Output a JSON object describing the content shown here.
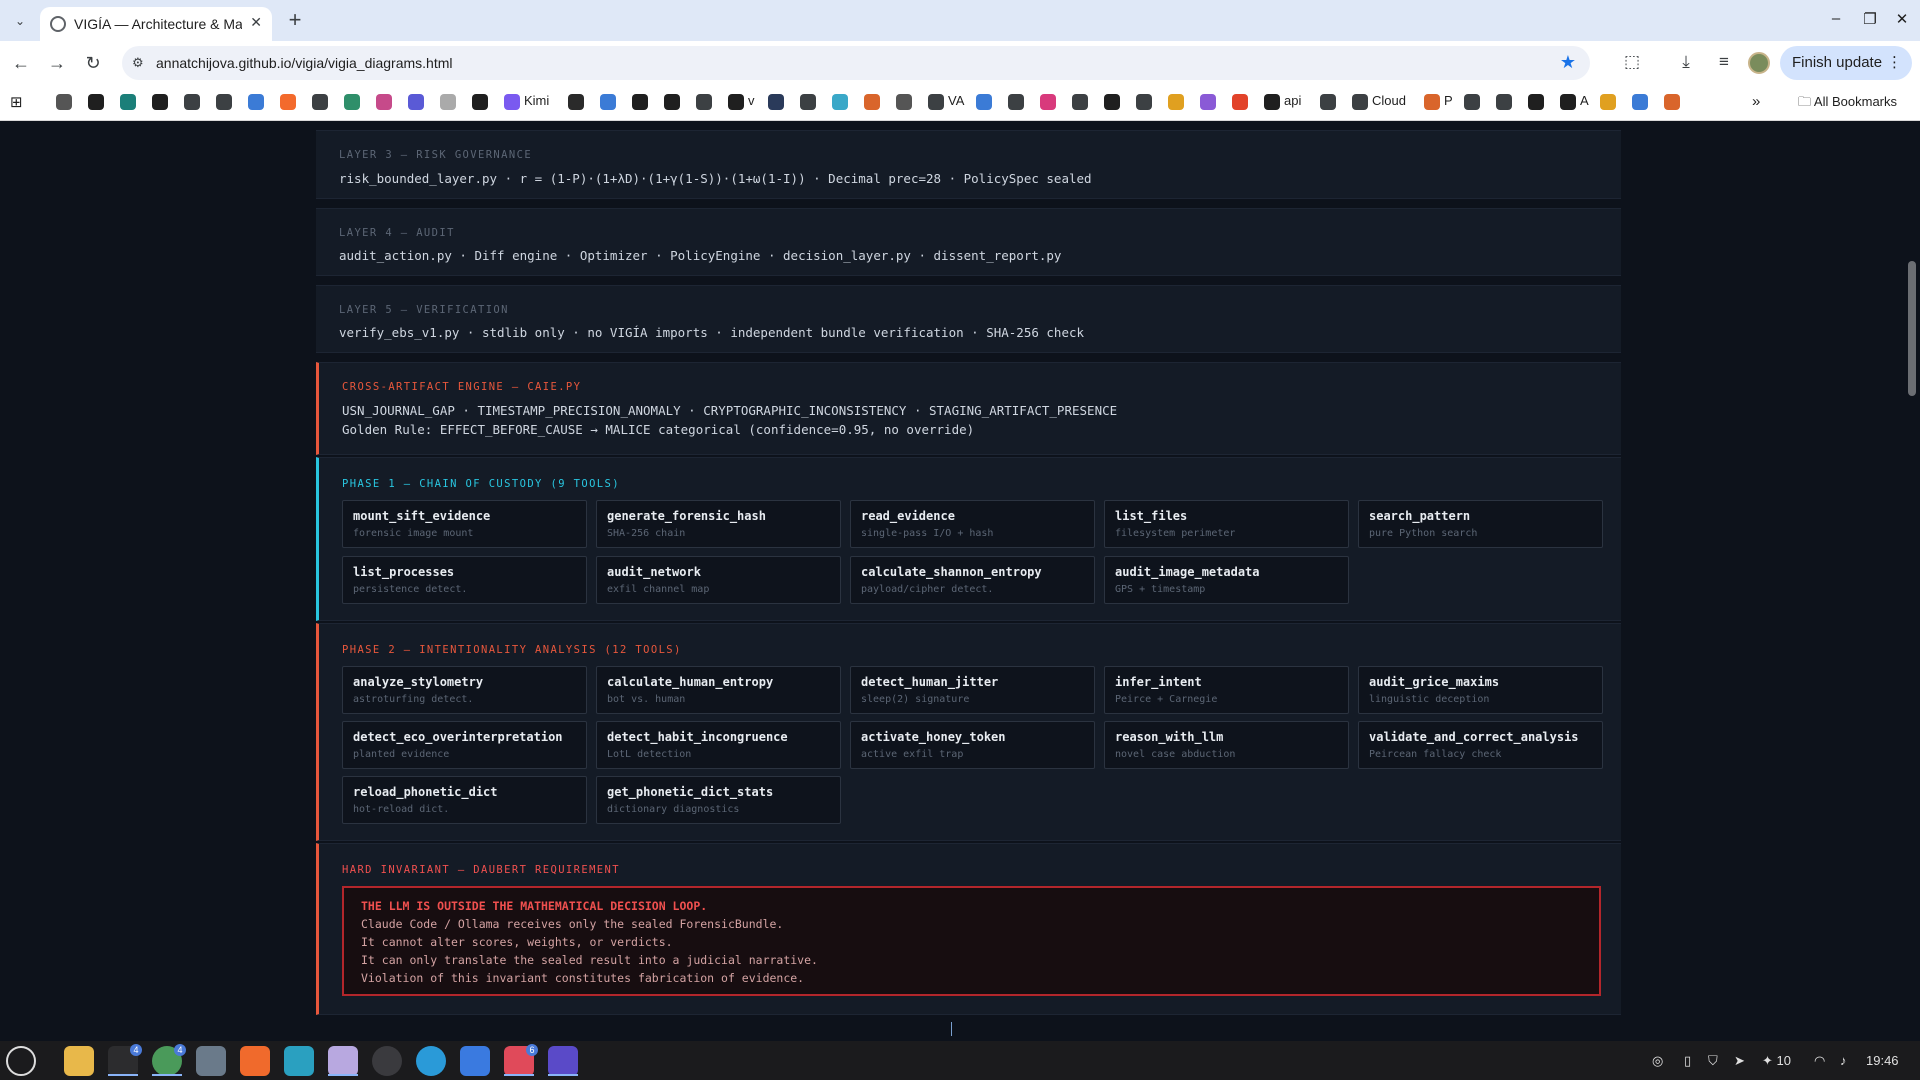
{
  "browser": {
    "tab_title": "VIGÍA — Architecture & Mat",
    "url": "annatchijova.github.io/vigia/vigia_diagrams.html",
    "finish_update": "Finish update",
    "all_bookmarks": "All Bookmarks",
    "bookmarks": [
      {
        "label": "",
        "icon": "ai-icon",
        "color": "#555555"
      },
      {
        "label": "",
        "icon": "github-icon",
        "color": "#1f1f1f"
      },
      {
        "label": "",
        "icon": "app-icon",
        "color": "#1b7f79"
      },
      {
        "label": "",
        "icon": "openai-icon",
        "color": "#1f1f1f"
      },
      {
        "label": "",
        "icon": "globe-icon",
        "color": "#3c4043"
      },
      {
        "label": "",
        "icon": "globe-icon",
        "color": "#3c4043"
      },
      {
        "label": "",
        "icon": "app-icon",
        "color": "#3b7bd6"
      },
      {
        "label": "",
        "icon": "bolt-icon",
        "color": "#f36a2c"
      },
      {
        "label": "",
        "icon": "globe-icon",
        "color": "#3c4043"
      },
      {
        "label": "",
        "icon": "stack-icon",
        "color": "#2f8f6a"
      },
      {
        "label": "",
        "icon": "app-icon",
        "color": "#c64a8a"
      },
      {
        "label": "",
        "icon": "app-icon",
        "color": "#5a5ad6"
      },
      {
        "label": "",
        "icon": "x-icon",
        "color": "#aaaaaa"
      },
      {
        "label": "",
        "icon": "triangle-icon",
        "color": "#1f1f1f"
      },
      {
        "label": "Kimi",
        "icon": "kimi-icon",
        "color": "#7a5af0"
      },
      {
        "label": "",
        "icon": "app-icon",
        "color": "#2a2a2a"
      },
      {
        "label": "",
        "icon": "sparkle-icon",
        "color": "#3b7bd6"
      },
      {
        "label": "",
        "icon": "triangle-icon",
        "color": "#1f1f1f"
      },
      {
        "label": "",
        "icon": "app-icon",
        "color": "#1f1f1f"
      },
      {
        "label": "",
        "icon": "globe-icon",
        "color": "#3c4043"
      },
      {
        "label": "v",
        "icon": "github-icon",
        "color": "#1f1f1f"
      },
      {
        "label": "",
        "icon": "app-icon",
        "color": "#2a3a5a"
      },
      {
        "label": "",
        "icon": "globe-icon",
        "color": "#3c4043"
      },
      {
        "label": "",
        "icon": "app-icon",
        "color": "#3aa8c8"
      },
      {
        "label": "",
        "icon": "asterisk-icon",
        "color": "#d9652b"
      },
      {
        "label": "",
        "icon": "ai-icon",
        "color": "#555555"
      },
      {
        "label": "VA",
        "icon": "globe-icon",
        "color": "#3c4043"
      },
      {
        "label": "",
        "icon": "sparkle-icon",
        "color": "#3b7bd6"
      },
      {
        "label": "",
        "icon": "globe-icon",
        "color": "#3c4043"
      },
      {
        "label": "",
        "icon": "slack-icon",
        "color": "#d83a7c"
      },
      {
        "label": "",
        "icon": "gear-icon",
        "color": "#3c4043"
      },
      {
        "label": "",
        "icon": "openai-icon",
        "color": "#1f1f1f"
      },
      {
        "label": "",
        "icon": "gear-icon",
        "color": "#3c4043"
      },
      {
        "label": "",
        "icon": "app-icon",
        "color": "#e0a020"
      },
      {
        "label": "",
        "icon": "app-icon",
        "color": "#8a5ad6"
      },
      {
        "label": "",
        "icon": "gitlab-icon",
        "color": "#e2432a"
      },
      {
        "label": "api",
        "icon": "k-icon",
        "color": "#1f1f1f"
      },
      {
        "label": "",
        "icon": "globe-icon",
        "color": "#3c4043"
      },
      {
        "label": "Cloud",
        "icon": "gear-icon",
        "color": "#3c4043"
      },
      {
        "label": "P",
        "icon": "asterisk-icon",
        "color": "#d9652b"
      },
      {
        "label": "",
        "icon": "gear-icon",
        "color": "#3c4043"
      },
      {
        "label": "",
        "icon": "globe-icon",
        "color": "#3c4043"
      },
      {
        "label": "",
        "icon": "github-icon",
        "color": "#1f1f1f"
      },
      {
        "label": "A",
        "icon": "github-icon",
        "color": "#1f1f1f"
      },
      {
        "label": "",
        "icon": "sparkle-icon",
        "color": "#e0a020"
      },
      {
        "label": "",
        "icon": "cloud-icon",
        "color": "#3b7bd6"
      },
      {
        "label": "",
        "icon": "asterisk-icon",
        "color": "#d9652b"
      }
    ]
  },
  "colors": {
    "orange": "#e8573c",
    "cyan": "#29c6e0",
    "muted": "#5c6675",
    "red": "#f0504f"
  },
  "layers": [
    {
      "label": "LAYER 3 — RISK GOVERNANCE",
      "text": "risk_bounded_layer.py · r = (1-P)·(1+λD)·(1+γ(1-S))·(1+ω(1-I)) · Decimal prec=28 · PolicySpec sealed"
    },
    {
      "label": "LAYER 4 — AUDIT",
      "text": "audit_action.py · Diff engine · Optimizer · PolicyEngine · decision_layer.py · dissent_report.py"
    },
    {
      "label": "LAYER 5 — VERIFICATION",
      "text": "verify_ebs_v1.py · stdlib only · no VIGÍA imports · independent bundle verification · SHA-256 check"
    }
  ],
  "caie": {
    "label": "CROSS-ARTIFACT ENGINE — CAIE.PY",
    "line1": "USN_JOURNAL_GAP · TIMESTAMP_PRECISION_ANOMALY · CRYPTOGRAPHIC_INCONSISTENCY · STAGING_ARTIFACT_PRESENCE",
    "line2": "Golden Rule: EFFECT_BEFORE_CAUSE → MALICE categorical (confidence=0.95, no override)"
  },
  "phase1": {
    "label": "PHASE 1 — CHAIN OF CUSTODY (9 TOOLS)",
    "tools": [
      {
        "name": "mount_sift_evidence",
        "desc": "forensic image mount"
      },
      {
        "name": "generate_forensic_hash",
        "desc": "SHA-256 chain"
      },
      {
        "name": "read_evidence",
        "desc": "single-pass I/O + hash"
      },
      {
        "name": "list_files",
        "desc": "filesystem perimeter"
      },
      {
        "name": "search_pattern",
        "desc": "pure Python search"
      },
      {
        "name": "list_processes",
        "desc": "persistence detect."
      },
      {
        "name": "audit_network",
        "desc": "exfil channel map"
      },
      {
        "name": "calculate_shannon_entropy",
        "desc": "payload/cipher detect."
      },
      {
        "name": "audit_image_metadata",
        "desc": "GPS + timestamp"
      }
    ]
  },
  "phase2": {
    "label": "PHASE 2 — INTENTIONALITY ANALYSIS (12 TOOLS)",
    "tools": [
      {
        "name": "analyze_stylometry",
        "desc": "astroturfing detect."
      },
      {
        "name": "calculate_human_entropy",
        "desc": "bot vs. human"
      },
      {
        "name": "detect_human_jitter",
        "desc": "sleep(2) signature"
      },
      {
        "name": "infer_intent",
        "desc": "Peirce + Carnegie"
      },
      {
        "name": "audit_grice_maxims",
        "desc": "linguistic deception"
      },
      {
        "name": "detect_eco_overinterpretation",
        "desc": "planted evidence"
      },
      {
        "name": "detect_habit_incongruence",
        "desc": "LotL detection"
      },
      {
        "name": "activate_honey_token",
        "desc": "active exfil trap"
      },
      {
        "name": "reason_with_llm",
        "desc": "novel case abduction"
      },
      {
        "name": "validate_and_correct_analysis",
        "desc": "Peircean fallacy check"
      },
      {
        "name": "reload_phonetic_dict",
        "desc": "hot-reload dict."
      },
      {
        "name": "get_phonetic_dict_stats",
        "desc": "dictionary diagnostics"
      }
    ]
  },
  "invariant": {
    "label": "HARD INVARIANT — DAUBERT REQUIREMENT",
    "heading": "THE LLM IS OUTSIDE THE MATHEMATICAL DECISION LOOP.",
    "lines": [
      "Claude Code / Ollama receives only the sealed ForensicBundle.",
      "It cannot alter scores, weights, or verdicts.",
      "It can only translate the sealed result into a judicial narrative.",
      "Violation of this invariant constitutes fabrication of evidence."
    ]
  },
  "taskbar": {
    "badges": [
      "4",
      "4",
      "6"
    ],
    "tray_count": "10",
    "time": "19:46"
  }
}
